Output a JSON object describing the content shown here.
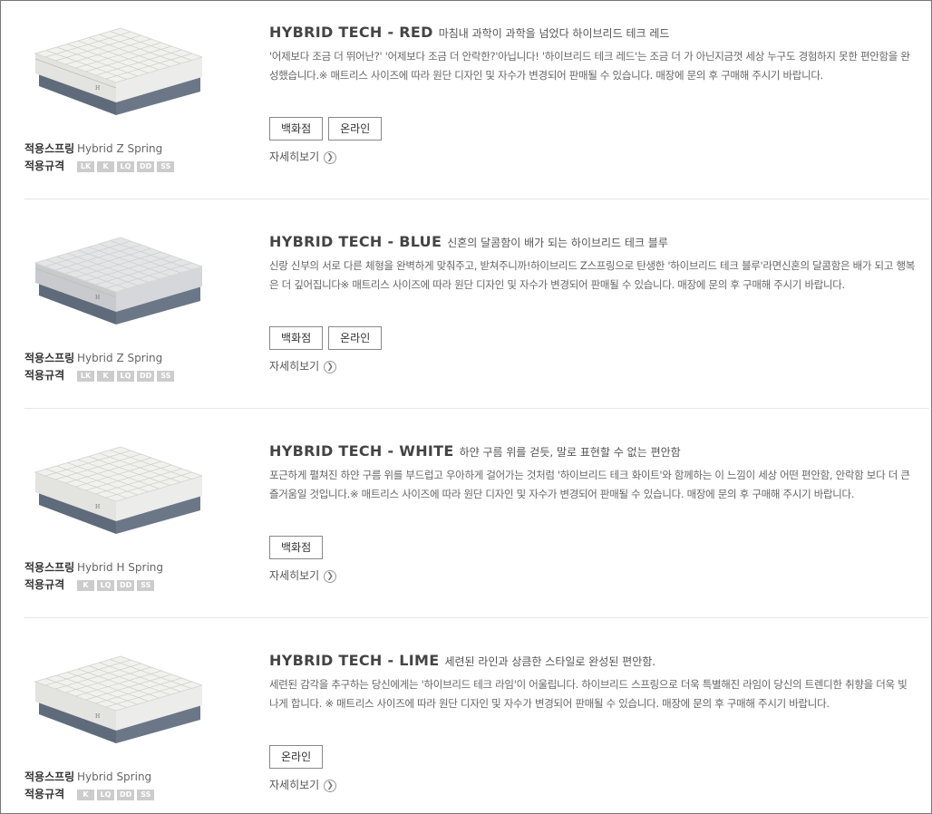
{
  "labels": {
    "spring": "적용스프링",
    "size": "적용규격",
    "more": "자세히보기",
    "more_icon": "chevron-right-circle-icon"
  },
  "products": [
    {
      "name": "HYBRID TECH - RED",
      "slogan": "마침내 과학이 과학을 넘었다 하이브리드 테크 레드",
      "desc": "'어제보다 조금 더 뛰어난?' '어제보다 조금 더 안락한?'아닙니다! '하이브리드 테크 레드'는 조금 더 가 아닌지금껏 세상 누구도 경험하지 못한 편안함을 완성했습니다.※ 매트리스 사이즈에 따라 원단 디자인 및 자수가 변경되어 판매될 수 있습니다. 매장에 문의 후 구매해 주시기 바랍니다.",
      "spring": "Hybrid Z Spring",
      "sizes": [
        "LK",
        "K",
        "LQ",
        "DD",
        "SS"
      ],
      "buttons": [
        "백화점",
        "온라인"
      ],
      "mattress_style": "pillowtop-white"
    },
    {
      "name": "HYBRID TECH - BLUE",
      "slogan": "신혼의 달콤함이 배가 되는 하이브리드 테크 블루",
      "desc": "신랑 신부의 서로 다른 체형을 완벽하게 맞춰주고, 받쳐주니까!하이브리드 Z스프링으로 탄생한 '하이브리드 테크 블루'라면신혼의 달콤함은 배가 되고 행복은 더 깊어집니다※ 매트리스 사이즈에 따라 원단 디자인 및 자수가 변경되어 판매될 수 있습니다. 매장에 문의 후 구매해 주시기 바랍니다.",
      "spring": "Hybrid Z Spring",
      "sizes": [
        "LK",
        "K",
        "LQ",
        "DD",
        "SS"
      ],
      "buttons": [
        "백화점",
        "온라인"
      ],
      "mattress_style": "pillowtop-grey"
    },
    {
      "name": "HYBRID TECH - WHITE",
      "slogan": "하얀 구름 위를 걷듯, 말로 표현할 수 없는 편안함",
      "desc": "포근하게 펼쳐진 하얀 구름 위를 부드럽고 우아하게 걸어가는 것처럼 '하이브리드 테크 화이트'와 함께하는 이 느낌이 세상 어떤 편안함, 안락함 보다 더 큰 즐거움일 것입니다.※ 매트리스 사이즈에 따라 원단 디자인 및 자수가 변경되어 판매될 수 있습니다. 매장에 문의 후 구매해 주시기 바랍니다.",
      "spring": "Hybrid H Spring",
      "sizes": [
        "K",
        "LQ",
        "DD",
        "SS"
      ],
      "buttons": [
        "백화점"
      ],
      "mattress_style": "tight-white"
    },
    {
      "name": "HYBRID TECH - LIME",
      "slogan": "세련된 라인과 상큼한 스타일로 완성된 편안함.",
      "desc": "세련된 감각을 추구하는 당신에게는 '하이브리드 테크 라임'이 어울립니다. 하이브리드 스프링으로 더욱 특별해진 라임이 당신의 트렌디한 취향을 더욱 빛나게 합니다. ※ 매트리스 사이즈에 따라 원단 디자인 및 자수가 변경되어 판매될 수 있습니다. 매장에 문의 후 구매해 주시기 바랍니다.",
      "spring": "Hybrid Spring",
      "sizes": [
        "K",
        "LQ",
        "DD",
        "SS"
      ],
      "buttons": [
        "온라인"
      ],
      "mattress_style": "tight-white"
    }
  ],
  "colors": {
    "base": "#6b7787",
    "top_white": "#f1f1ee",
    "top_grey": "#e4e5e7",
    "badge": "#cccccc"
  }
}
